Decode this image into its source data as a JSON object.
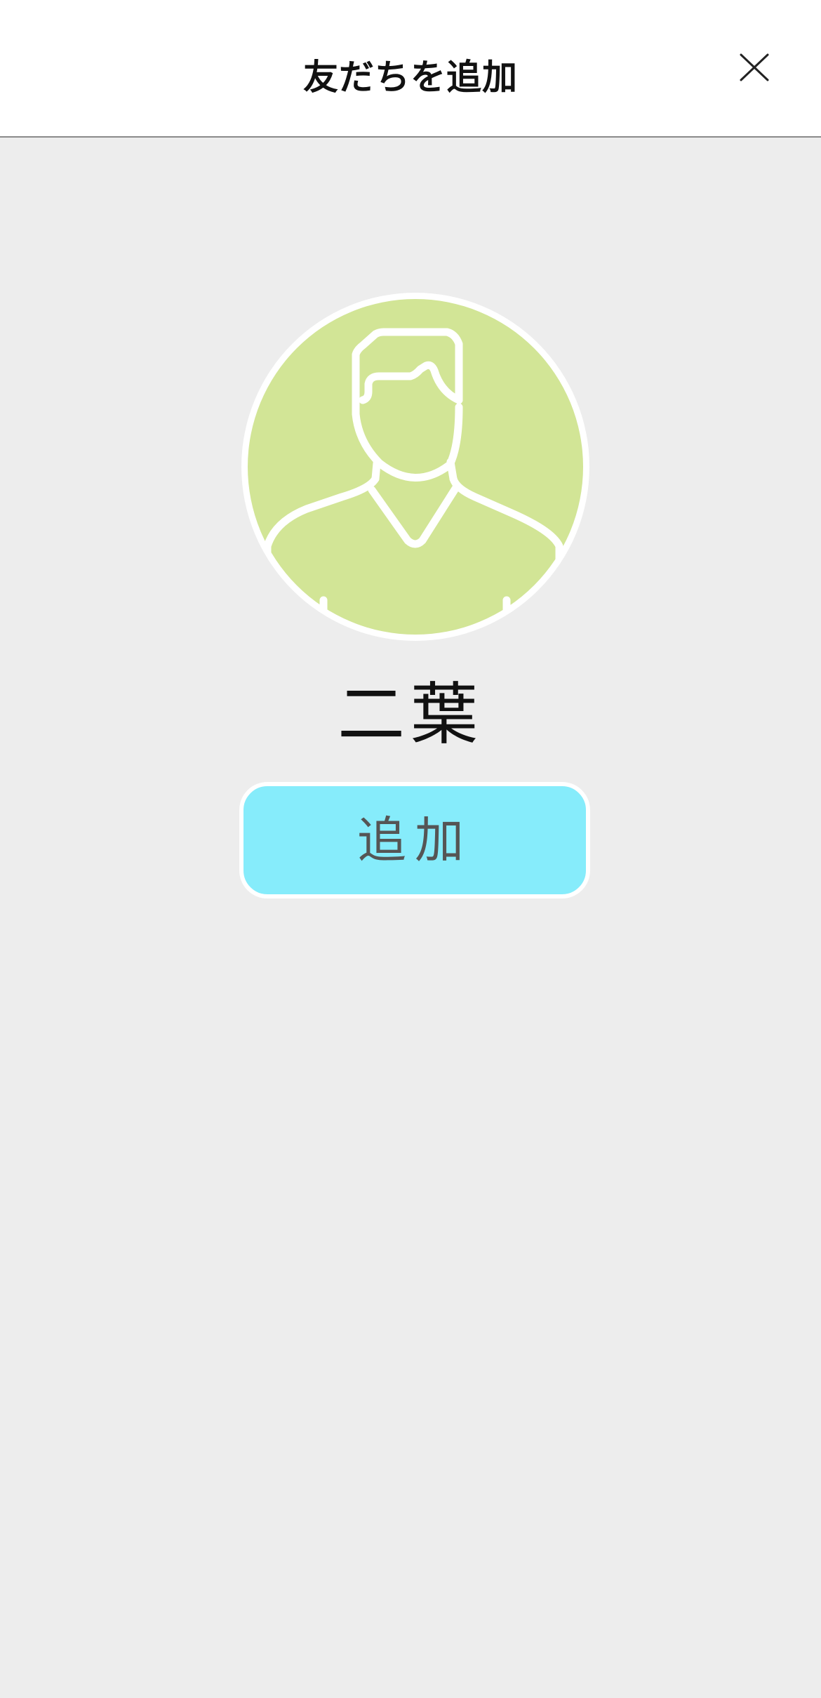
{
  "header": {
    "title": "友だちを追加",
    "close_icon": "close-icon"
  },
  "profile": {
    "avatar_icon": "person-avatar-icon",
    "avatar_bg_color": "#d2e596",
    "name": "二葉"
  },
  "actions": {
    "add_label": "追加",
    "add_button_color": "#86ecfb"
  },
  "colors": {
    "background": "#ededed",
    "header_bg": "#ffffff"
  }
}
